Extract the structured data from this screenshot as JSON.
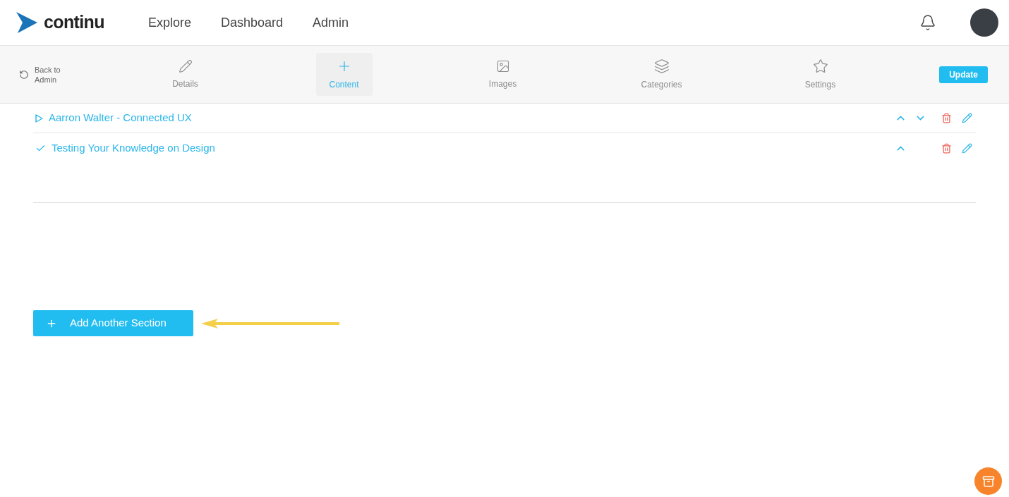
{
  "header": {
    "logo": "continu",
    "nav": [
      {
        "label": "Explore"
      },
      {
        "label": "Dashboard"
      },
      {
        "label": "Admin"
      }
    ]
  },
  "toolbar": {
    "back": "Back to Admin",
    "tabs": [
      {
        "label": "Details",
        "kind": "pencil",
        "selected": false
      },
      {
        "label": "Content",
        "kind": "plus",
        "selected": true
      },
      {
        "label": "Images",
        "kind": "image",
        "selected": false
      },
      {
        "label": "Categories",
        "kind": "layers",
        "selected": false
      },
      {
        "label": "Settings",
        "kind": "star",
        "selected": false
      }
    ],
    "update": "Update"
  },
  "sections": [
    {
      "title": "Aarron Walter - Connected UX",
      "kind": "video",
      "move_up": true,
      "move_down": true
    },
    {
      "title": "Testing Your Knowledge on Design",
      "kind": "quiz",
      "move_up": true,
      "move_down": false
    }
  ],
  "add_section": "Add Another Section"
}
